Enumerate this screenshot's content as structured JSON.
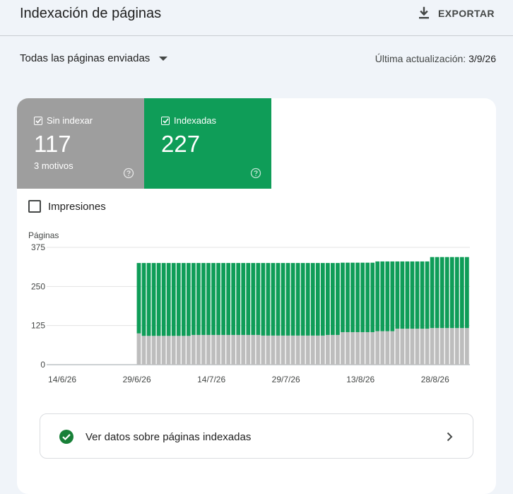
{
  "header": {
    "title": "Indexación de páginas",
    "export_label": "EXPORTAR",
    "export_icon": "download-icon"
  },
  "filters": {
    "page_set": "Todas las páginas enviadas",
    "last_update_label": "Última actualización:",
    "last_update_value": "3/9/26"
  },
  "tiles": {
    "not_indexed": {
      "label": "Sin indexar",
      "value": "117",
      "sub": "3 motivos",
      "color": "#9e9e9e"
    },
    "indexed": {
      "label": "Indexadas",
      "value": "227",
      "color": "#0f9d58"
    }
  },
  "impressions_label": "Impresiones",
  "chart_data": {
    "type": "bar",
    "stacked": true,
    "ylabel": "Páginas",
    "ylim": [
      0,
      375
    ],
    "yticks": [
      "0",
      "125",
      "250",
      "375"
    ],
    "xtick_labels": [
      "14/6/26",
      "29/6/26",
      "14/7/26",
      "29/7/26",
      "13/8/26",
      "28/8/26"
    ],
    "grid": true,
    "bar_range": {
      "first_date": "29/6/26",
      "last_date": "3/9/26",
      "empty_days_before": 17
    },
    "series": [
      {
        "name": "Sin indexar",
        "color": "#bdbdbd",
        "values": [
          100,
          92,
          92,
          92,
          92,
          92,
          92,
          92,
          92,
          92,
          92,
          95,
          95,
          95,
          95,
          95,
          95,
          95,
          95,
          95,
          95,
          95,
          95,
          95,
          95,
          93,
          93,
          93,
          93,
          93,
          93,
          93,
          93,
          93,
          93,
          93,
          93,
          93,
          95,
          95,
          95,
          104,
          104,
          104,
          104,
          104,
          104,
          104,
          107,
          107,
          107,
          107,
          115,
          115,
          115,
          115,
          115,
          115,
          115,
          117,
          117,
          117,
          117,
          117,
          117,
          117,
          117
        ]
      },
      {
        "name": "Indexadas",
        "color": "#0f9d58",
        "values": [
          225,
          233,
          233,
          233,
          233,
          233,
          233,
          233,
          233,
          233,
          233,
          230,
          230,
          230,
          230,
          230,
          230,
          230,
          230,
          230,
          230,
          230,
          230,
          230,
          230,
          232,
          232,
          232,
          232,
          232,
          232,
          232,
          232,
          232,
          232,
          232,
          232,
          232,
          230,
          230,
          230,
          222,
          222,
          222,
          222,
          222,
          222,
          222,
          223,
          223,
          223,
          223,
          215,
          215,
          215,
          215,
          215,
          215,
          215,
          227,
          227,
          227,
          227,
          227,
          227,
          227,
          227
        ]
      }
    ]
  },
  "view_link": {
    "label": "Ver datos sobre páginas indexadas",
    "status_color": "#188038"
  }
}
